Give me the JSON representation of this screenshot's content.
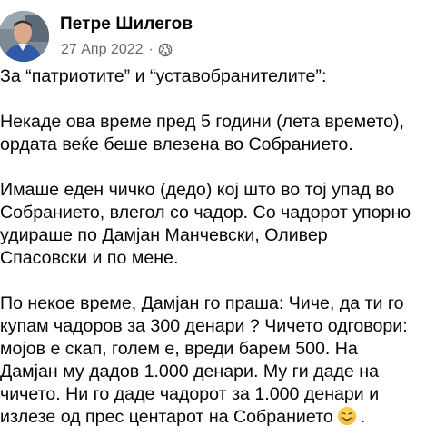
{
  "post": {
    "author": "Петре Шилегов",
    "date": "27 Апр 2022",
    "separator": "·",
    "privacy_icon": "globe-icon",
    "paragraphs": [
      "За “патриотите” и “уставобранителите”:",
      "Некаде ова време пред 5 години (лета времето),\nордата веќе беше влезена во Собранието.",
      "Имаше еден чичко (дедо) кој што во тој упад  во\nСобранието, влегол со чадор. Со чадорот упорно\nудираше по Дамјан Манчевски, Оливер\nСпасовски и по мене.",
      "По некое време, Дамјан го праша: Чиче, да ти го\nкупам чадоров за 300 денари ? Чичето одговори:\nмојов е скап, голем е, вреди барем 500. На\nДамјан му дадов 1.000 денари. Му ги даде на\nчичето. Ни го даде чадорот за 1.000 денари и\nизлезе од прес центарот на Собранието"
    ],
    "trailing_punct": ".",
    "emoji_icon": "smiling-face-emoji"
  }
}
